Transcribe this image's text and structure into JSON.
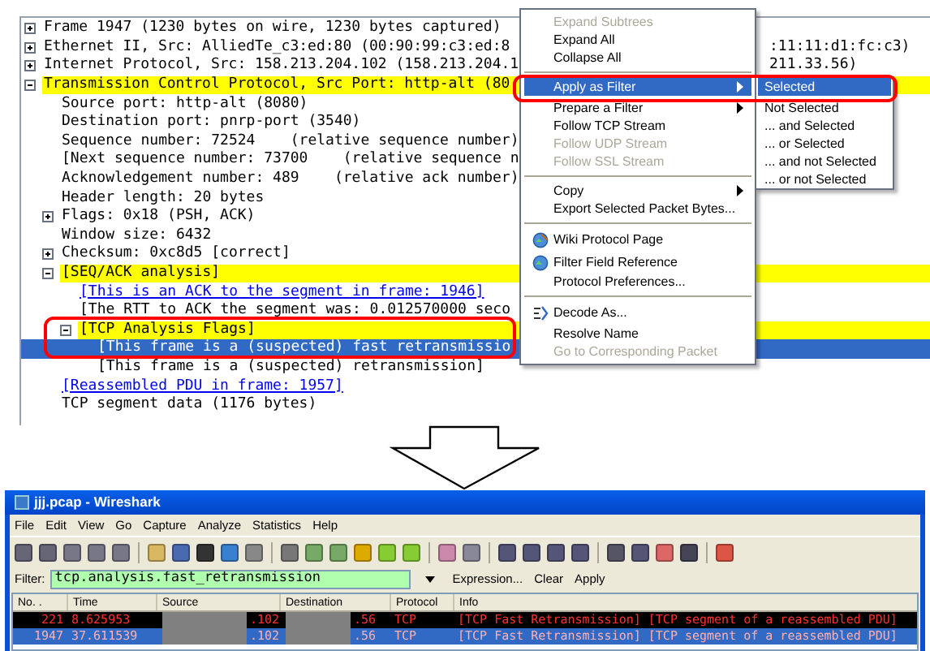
{
  "tree": [
    {
      "text": "Frame 1947 (1230 bytes on wire, 1230 bytes captured)",
      "expanded": false,
      "highlighted": false,
      "selected": false,
      "kind": "field"
    },
    {
      "text": "Ethernet II, Src: AlliedTe_c3:ed:80 (00:90:99:c3:ed:8",
      "right_text": ":11:11:d1:fc:c3)",
      "expanded": false,
      "highlighted": false,
      "selected": false,
      "kind": "field"
    },
    {
      "text": "Internet Protocol, Src: 158.213.204.102 (158.213.204.1",
      "right_text": "211.33.56)",
      "expanded": false,
      "highlighted": false,
      "selected": false,
      "kind": "field"
    },
    {
      "text": "Transmission Control Protocol, Src Port: http-alt (80",
      "expanded": true,
      "highlighted": true,
      "selected": false,
      "kind": "field",
      "children": [
        {
          "text": "Source port: http-alt (8080)",
          "highlighted": false,
          "selected": false,
          "kind": "field"
        },
        {
          "text": "Destination port: pnrp-port (3540)",
          "highlighted": false,
          "selected": false,
          "kind": "field"
        },
        {
          "text": "Sequence number: 72524    (relative sequence number)",
          "highlighted": false,
          "selected": false,
          "kind": "field"
        },
        {
          "text": "[Next sequence number: 73700    (relative sequence n",
          "highlighted": false,
          "selected": false,
          "kind": "field"
        },
        {
          "text": "Acknowledgement number: 489    (relative ack number)",
          "highlighted": false,
          "selected": false,
          "kind": "field"
        },
        {
          "text": "Header length: 20 bytes",
          "highlighted": false,
          "selected": false,
          "kind": "field"
        },
        {
          "text": "Flags: 0x18 (PSH, ACK)",
          "expanded": false,
          "highlighted": false,
          "selected": false,
          "kind": "field"
        },
        {
          "text": "Window size: 6432",
          "highlighted": false,
          "selected": false,
          "kind": "field"
        },
        {
          "text": "Checksum: 0xc8d5 [correct]",
          "expanded": false,
          "highlighted": false,
          "selected": false,
          "kind": "field"
        },
        {
          "text": "[SEQ/ACK analysis]",
          "expanded": true,
          "highlighted": true,
          "selected": false,
          "kind": "field",
          "children": [
            {
              "text": "[This is an ACK to the segment in frame: 1946]",
              "highlighted": false,
              "selected": false,
              "kind": "link"
            },
            {
              "text": "[The RTT to ACK the segment was: 0.012570000 seco",
              "highlighted": false,
              "selected": false,
              "kind": "field"
            },
            {
              "text": "[TCP Analysis Flags]",
              "expanded": true,
              "highlighted": true,
              "selected": false,
              "kind": "field",
              "children": [
                {
                  "text": "[This frame is a (suspected) fast retransmissio",
                  "highlighted": false,
                  "selected": true,
                  "kind": "field"
                },
                {
                  "text": "[This frame is a (suspected) retransmission]",
                  "highlighted": false,
                  "selected": false,
                  "kind": "field"
                }
              ]
            }
          ]
        },
        {
          "text": "[Reassembled PDU in frame: 1957]",
          "highlighted": false,
          "selected": false,
          "kind": "link"
        },
        {
          "text": "TCP segment data (1176 bytes)",
          "highlighted": false,
          "selected": false,
          "kind": "field"
        }
      ]
    }
  ],
  "context_menu": [
    {
      "kind": "item",
      "label": "Expand Subtrees",
      "disabled": true,
      "selected": false,
      "submenu": false
    },
    {
      "kind": "item",
      "label": "Expand All",
      "disabled": false,
      "selected": false,
      "submenu": false
    },
    {
      "kind": "item",
      "label": "Collapse All",
      "disabled": false,
      "selected": false,
      "submenu": false
    },
    {
      "kind": "separator"
    },
    {
      "kind": "item",
      "label": "Apply as Filter",
      "disabled": false,
      "selected": true,
      "submenu": true
    },
    {
      "kind": "item",
      "label": "Prepare a Filter",
      "disabled": false,
      "selected": false,
      "submenu": true
    },
    {
      "kind": "item",
      "label": "Follow TCP Stream",
      "disabled": false,
      "selected": false,
      "submenu": false
    },
    {
      "kind": "item",
      "label": "Follow UDP Stream",
      "disabled": true,
      "selected": false,
      "submenu": false
    },
    {
      "kind": "item",
      "label": "Follow SSL Stream",
      "disabled": true,
      "selected": false,
      "submenu": false
    },
    {
      "kind": "separator"
    },
    {
      "kind": "item",
      "label": "Copy",
      "disabled": false,
      "selected": false,
      "submenu": true
    },
    {
      "kind": "item",
      "label": "Export Selected Packet Bytes...",
      "disabled": false,
      "selected": false,
      "submenu": false
    },
    {
      "kind": "separator"
    },
    {
      "kind": "icon_item",
      "label": "Wiki Protocol Page",
      "disabled": false,
      "selected": false,
      "submenu": false
    },
    {
      "kind": "icon_item",
      "label": "Filter Field Reference",
      "disabled": false,
      "selected": false,
      "submenu": false
    },
    {
      "kind": "item",
      "label": "Protocol Preferences...",
      "disabled": false,
      "selected": false,
      "submenu": false
    },
    {
      "kind": "separator"
    },
    {
      "kind": "icon_item",
      "label": "Decode As...",
      "disabled": false,
      "selected": false,
      "submenu": false
    },
    {
      "kind": "item",
      "label": "Resolve Name",
      "disabled": false,
      "selected": false,
      "submenu": false
    },
    {
      "kind": "item",
      "label": "Go to Corresponding Packet",
      "disabled": true,
      "selected": false,
      "submenu": false
    }
  ],
  "submenu": [
    {
      "label": "Selected",
      "selected": true
    },
    {
      "label": "Not Selected",
      "selected": false
    },
    {
      "label": "... and Selected",
      "selected": false
    },
    {
      "label": "... or Selected",
      "selected": false
    },
    {
      "label": "... and not Selected",
      "selected": false
    },
    {
      "label": "... or not Selected",
      "selected": false
    }
  ],
  "window": {
    "title": "jjj.pcap - Wireshark"
  },
  "menu_bar": [
    "File",
    "Edit",
    "View",
    "Go",
    "Capture",
    "Analyze",
    "Statistics",
    "Help"
  ],
  "filter_bar": {
    "label": "Filter:",
    "value": "tcp.analysis.fast_retransmission",
    "valid": true,
    "buttons": [
      "Expression...",
      "Clear",
      "Apply"
    ]
  },
  "packet_list": {
    "columns": [
      "No. .",
      "Time",
      "Source",
      "Destination",
      "Protocol",
      "Info"
    ],
    "rows": [
      {
        "no": "221",
        "time": "8.625953",
        "source": ".102",
        "source_redacted": true,
        "destination": ".56",
        "destination_redacted": true,
        "protocol": "TCP",
        "info": "[TCP Fast Retransmission] [TCP segment of a reassembled PDU]",
        "selected": false
      },
      {
        "no": "1947",
        "time": "37.611539",
        "source": ".102",
        "source_redacted": true,
        "destination": ".56",
        "destination_redacted": true,
        "protocol": "TCP",
        "info": "[TCP Fast Retransmission] [TCP segment of a reassembled PDU]",
        "selected": true
      }
    ]
  }
}
